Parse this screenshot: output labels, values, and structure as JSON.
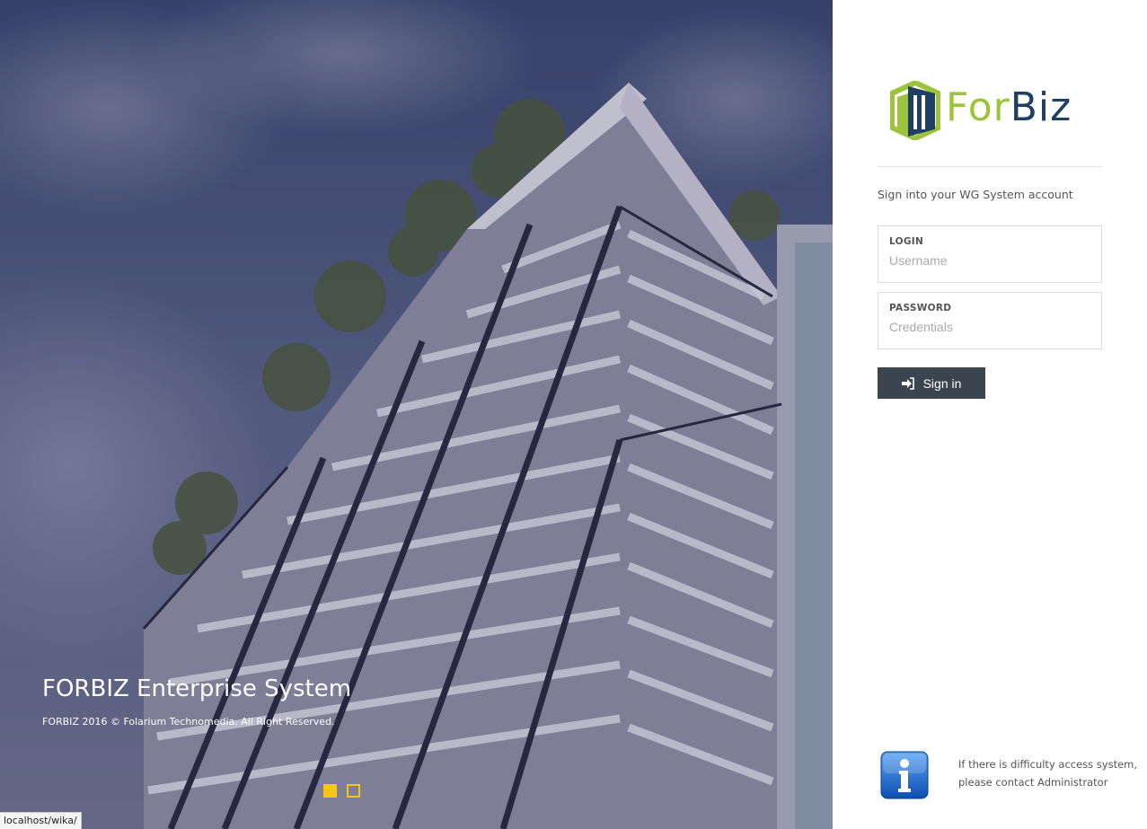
{
  "hero": {
    "title": "FORBIZ Enterprise System",
    "subtitle": "FORBIZ 2016 © Folarium Technomedia. All Right Reserved.",
    "slides": [
      {
        "active": true
      },
      {
        "active": false
      }
    ],
    "accent_color": "#f5c518"
  },
  "status_bar": {
    "url": "localhost/wika/"
  },
  "brand": {
    "logo_part1": "For",
    "logo_part2": "Biz",
    "color_green": "#9bc43a",
    "color_navy": "#1f3f63"
  },
  "login_form": {
    "prompt": "Sign into your WG System account",
    "username": {
      "label": "LOGIN",
      "placeholder": "Username",
      "value": ""
    },
    "password": {
      "label": "PASSWORD",
      "placeholder": "Credentials",
      "value": ""
    },
    "submit_label": "Sign in",
    "submit_icon": "sign-in-icon",
    "button_color": "#3b4550"
  },
  "help": {
    "icon": "info-icon",
    "line1": "If there is difficulty access system,",
    "line2": "please contact Administrator"
  }
}
